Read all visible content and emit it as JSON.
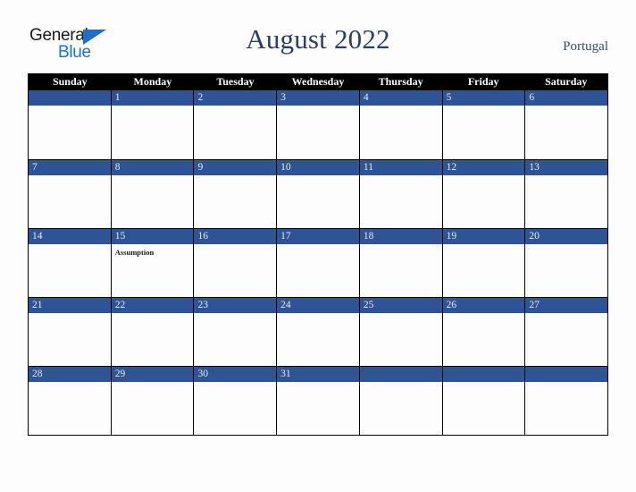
{
  "brand": {
    "name_part1": "General",
    "name_part2": "Blue",
    "triangle_icon": "triangle-icon",
    "colors": {
      "text_dark": "#1a1a1a",
      "blue": "#1f6fc4"
    }
  },
  "header": {
    "title": "August 2022",
    "region": "Portugal",
    "title_color": "#2c3e63",
    "region_color": "#3a4a6b"
  },
  "calendar": {
    "month": "August",
    "year": "2022",
    "colors": {
      "dow_header_bg": "#000000",
      "dow_header_text": "#ffffff",
      "date_band_bg": "#2e5496",
      "date_text": "#e8eaf0",
      "cell_bg": "#fdfdfd",
      "border": "#000000"
    },
    "day_headers": [
      "Sunday",
      "Monday",
      "Tuesday",
      "Wednesday",
      "Thursday",
      "Friday",
      "Saturday"
    ],
    "weeks": [
      [
        {
          "date": "",
          "event": ""
        },
        {
          "date": "1",
          "event": ""
        },
        {
          "date": "2",
          "event": ""
        },
        {
          "date": "3",
          "event": ""
        },
        {
          "date": "4",
          "event": ""
        },
        {
          "date": "5",
          "event": ""
        },
        {
          "date": "6",
          "event": ""
        }
      ],
      [
        {
          "date": "7",
          "event": ""
        },
        {
          "date": "8",
          "event": ""
        },
        {
          "date": "9",
          "event": ""
        },
        {
          "date": "10",
          "event": ""
        },
        {
          "date": "11",
          "event": ""
        },
        {
          "date": "12",
          "event": ""
        },
        {
          "date": "13",
          "event": ""
        }
      ],
      [
        {
          "date": "14",
          "event": ""
        },
        {
          "date": "15",
          "event": "Assumption"
        },
        {
          "date": "16",
          "event": ""
        },
        {
          "date": "17",
          "event": ""
        },
        {
          "date": "18",
          "event": ""
        },
        {
          "date": "19",
          "event": ""
        },
        {
          "date": "20",
          "event": ""
        }
      ],
      [
        {
          "date": "21",
          "event": ""
        },
        {
          "date": "22",
          "event": ""
        },
        {
          "date": "23",
          "event": ""
        },
        {
          "date": "24",
          "event": ""
        },
        {
          "date": "25",
          "event": ""
        },
        {
          "date": "26",
          "event": ""
        },
        {
          "date": "27",
          "event": ""
        }
      ],
      [
        {
          "date": "28",
          "event": ""
        },
        {
          "date": "29",
          "event": ""
        },
        {
          "date": "30",
          "event": ""
        },
        {
          "date": "31",
          "event": ""
        },
        {
          "date": "",
          "event": ""
        },
        {
          "date": "",
          "event": ""
        },
        {
          "date": "",
          "event": ""
        }
      ]
    ]
  }
}
